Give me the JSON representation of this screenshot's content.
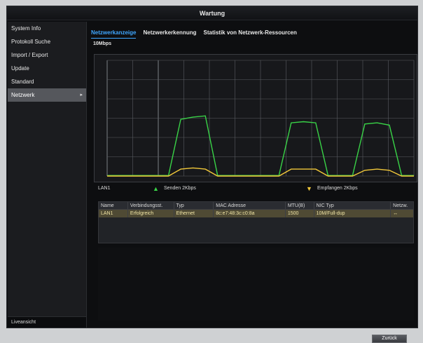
{
  "window": {
    "title": "Wartung"
  },
  "sidebar": {
    "items": [
      {
        "label": "System Info"
      },
      {
        "label": "Protokoll Suche"
      },
      {
        "label": "Import / Export"
      },
      {
        "label": "Update"
      },
      {
        "label": "Standard"
      },
      {
        "label": "Netzwerk",
        "active": true,
        "chevron": "▸"
      }
    ],
    "footer_label": "Liveansicht"
  },
  "tabs": [
    {
      "label": "Netzwerkanzeige",
      "active": true
    },
    {
      "label": "Netzwerkerkennung"
    },
    {
      "label": "Statistik von Netzwerk-Ressourcen"
    }
  ],
  "traffic": {
    "rate_label": "10Mbps",
    "interface": "LAN1",
    "sent_label": "Senden 2Kbps",
    "received_label": "Empfangen 2Kbps",
    "colors": {
      "sent": "#39d347",
      "received": "#f1c83a",
      "grid": "#5a5d63"
    }
  },
  "chart_data": {
    "type": "line",
    "series": [
      {
        "name": "Senden 2Kbps",
        "x": [
          0,
          4,
          8,
          12,
          16,
          20,
          24,
          28,
          32,
          36,
          40,
          44,
          48,
          52,
          56,
          60,
          64,
          68,
          72,
          76,
          80,
          84,
          88,
          92,
          96,
          100
        ],
        "values": [
          0.05,
          0.05,
          0.05,
          0.05,
          0.05,
          0.05,
          4.9,
          5.1,
          5.2,
          0.05,
          0.05,
          0.05,
          0.05,
          0.05,
          0.05,
          4.6,
          4.7,
          4.6,
          0.05,
          0.05,
          0.05,
          4.5,
          4.6,
          4.4,
          0.05,
          0.05
        ]
      },
      {
        "name": "Empfangen 2Kbps",
        "x": [
          0,
          4,
          8,
          12,
          16,
          20,
          24,
          28,
          32,
          36,
          40,
          44,
          48,
          52,
          56,
          60,
          64,
          68,
          72,
          76,
          80,
          84,
          88,
          92,
          96,
          100
        ],
        "values": [
          0.0,
          0.0,
          0.0,
          0.0,
          0.0,
          0.0,
          0.6,
          0.7,
          0.6,
          0.0,
          0.0,
          0.0,
          0.0,
          0.0,
          0.0,
          0.6,
          0.6,
          0.6,
          0.0,
          0.0,
          0.0,
          0.5,
          0.6,
          0.5,
          0.0,
          0.0
        ]
      }
    ],
    "ylim": [
      0,
      10
    ],
    "grid": true
  },
  "nic_table": {
    "headers": [
      "Name",
      "Verbindungsst.",
      "Typ",
      "MAC Adresse",
      "MTU(B)",
      "NIC Typ",
      "Netzw."
    ],
    "rows": [
      [
        "LAN1",
        "Erfolgreich",
        "Ethernet",
        "8c:e7:48:3c:c0:8a",
        "1500",
        "10M/Full-dup",
        "↔"
      ]
    ]
  },
  "buttons": {
    "back_label": "Zurück"
  }
}
